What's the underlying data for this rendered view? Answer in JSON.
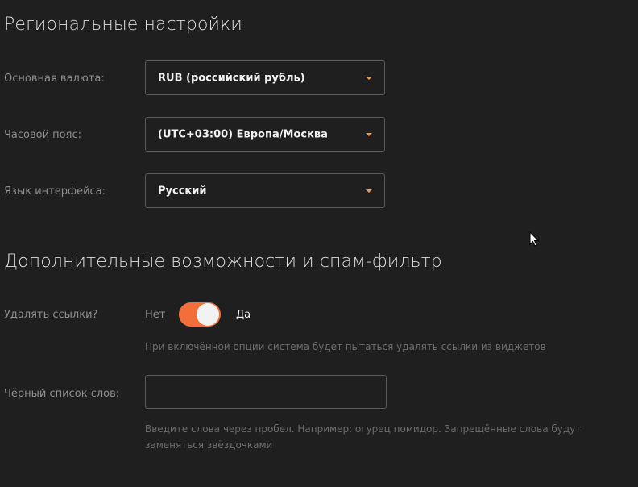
{
  "regional": {
    "heading": "Региональные настройки",
    "currency": {
      "label": "Основная валюта:",
      "value": "RUB (российский рубль)"
    },
    "timezone": {
      "label": "Часовой пояс:",
      "value": "(UTC+03:00) Европа/Москва"
    },
    "language": {
      "label": "Язык интерфейса:",
      "value": "Русский"
    }
  },
  "spam": {
    "heading": "Дополнительные возможности и спам-фильтр",
    "remove_links": {
      "label": "Удалять ссылки?",
      "off_label": "Нет",
      "on_label": "Да",
      "enabled": true,
      "hint": "При включённой опции система будет пытаться удалять ссылки из виджетов"
    },
    "blacklist": {
      "label": "Чёрный список слов:",
      "value": "",
      "hint": "Введите слова через пробел. Например: огурец помидор. Запрещённые слова будут заменяться звёздочками"
    }
  },
  "colors": {
    "accent": "#f26f3a",
    "caret": "#f2994a",
    "background": "#1f1f1f"
  },
  "icons": [
    "chevron-down-icon",
    "mouse-cursor-icon"
  ]
}
